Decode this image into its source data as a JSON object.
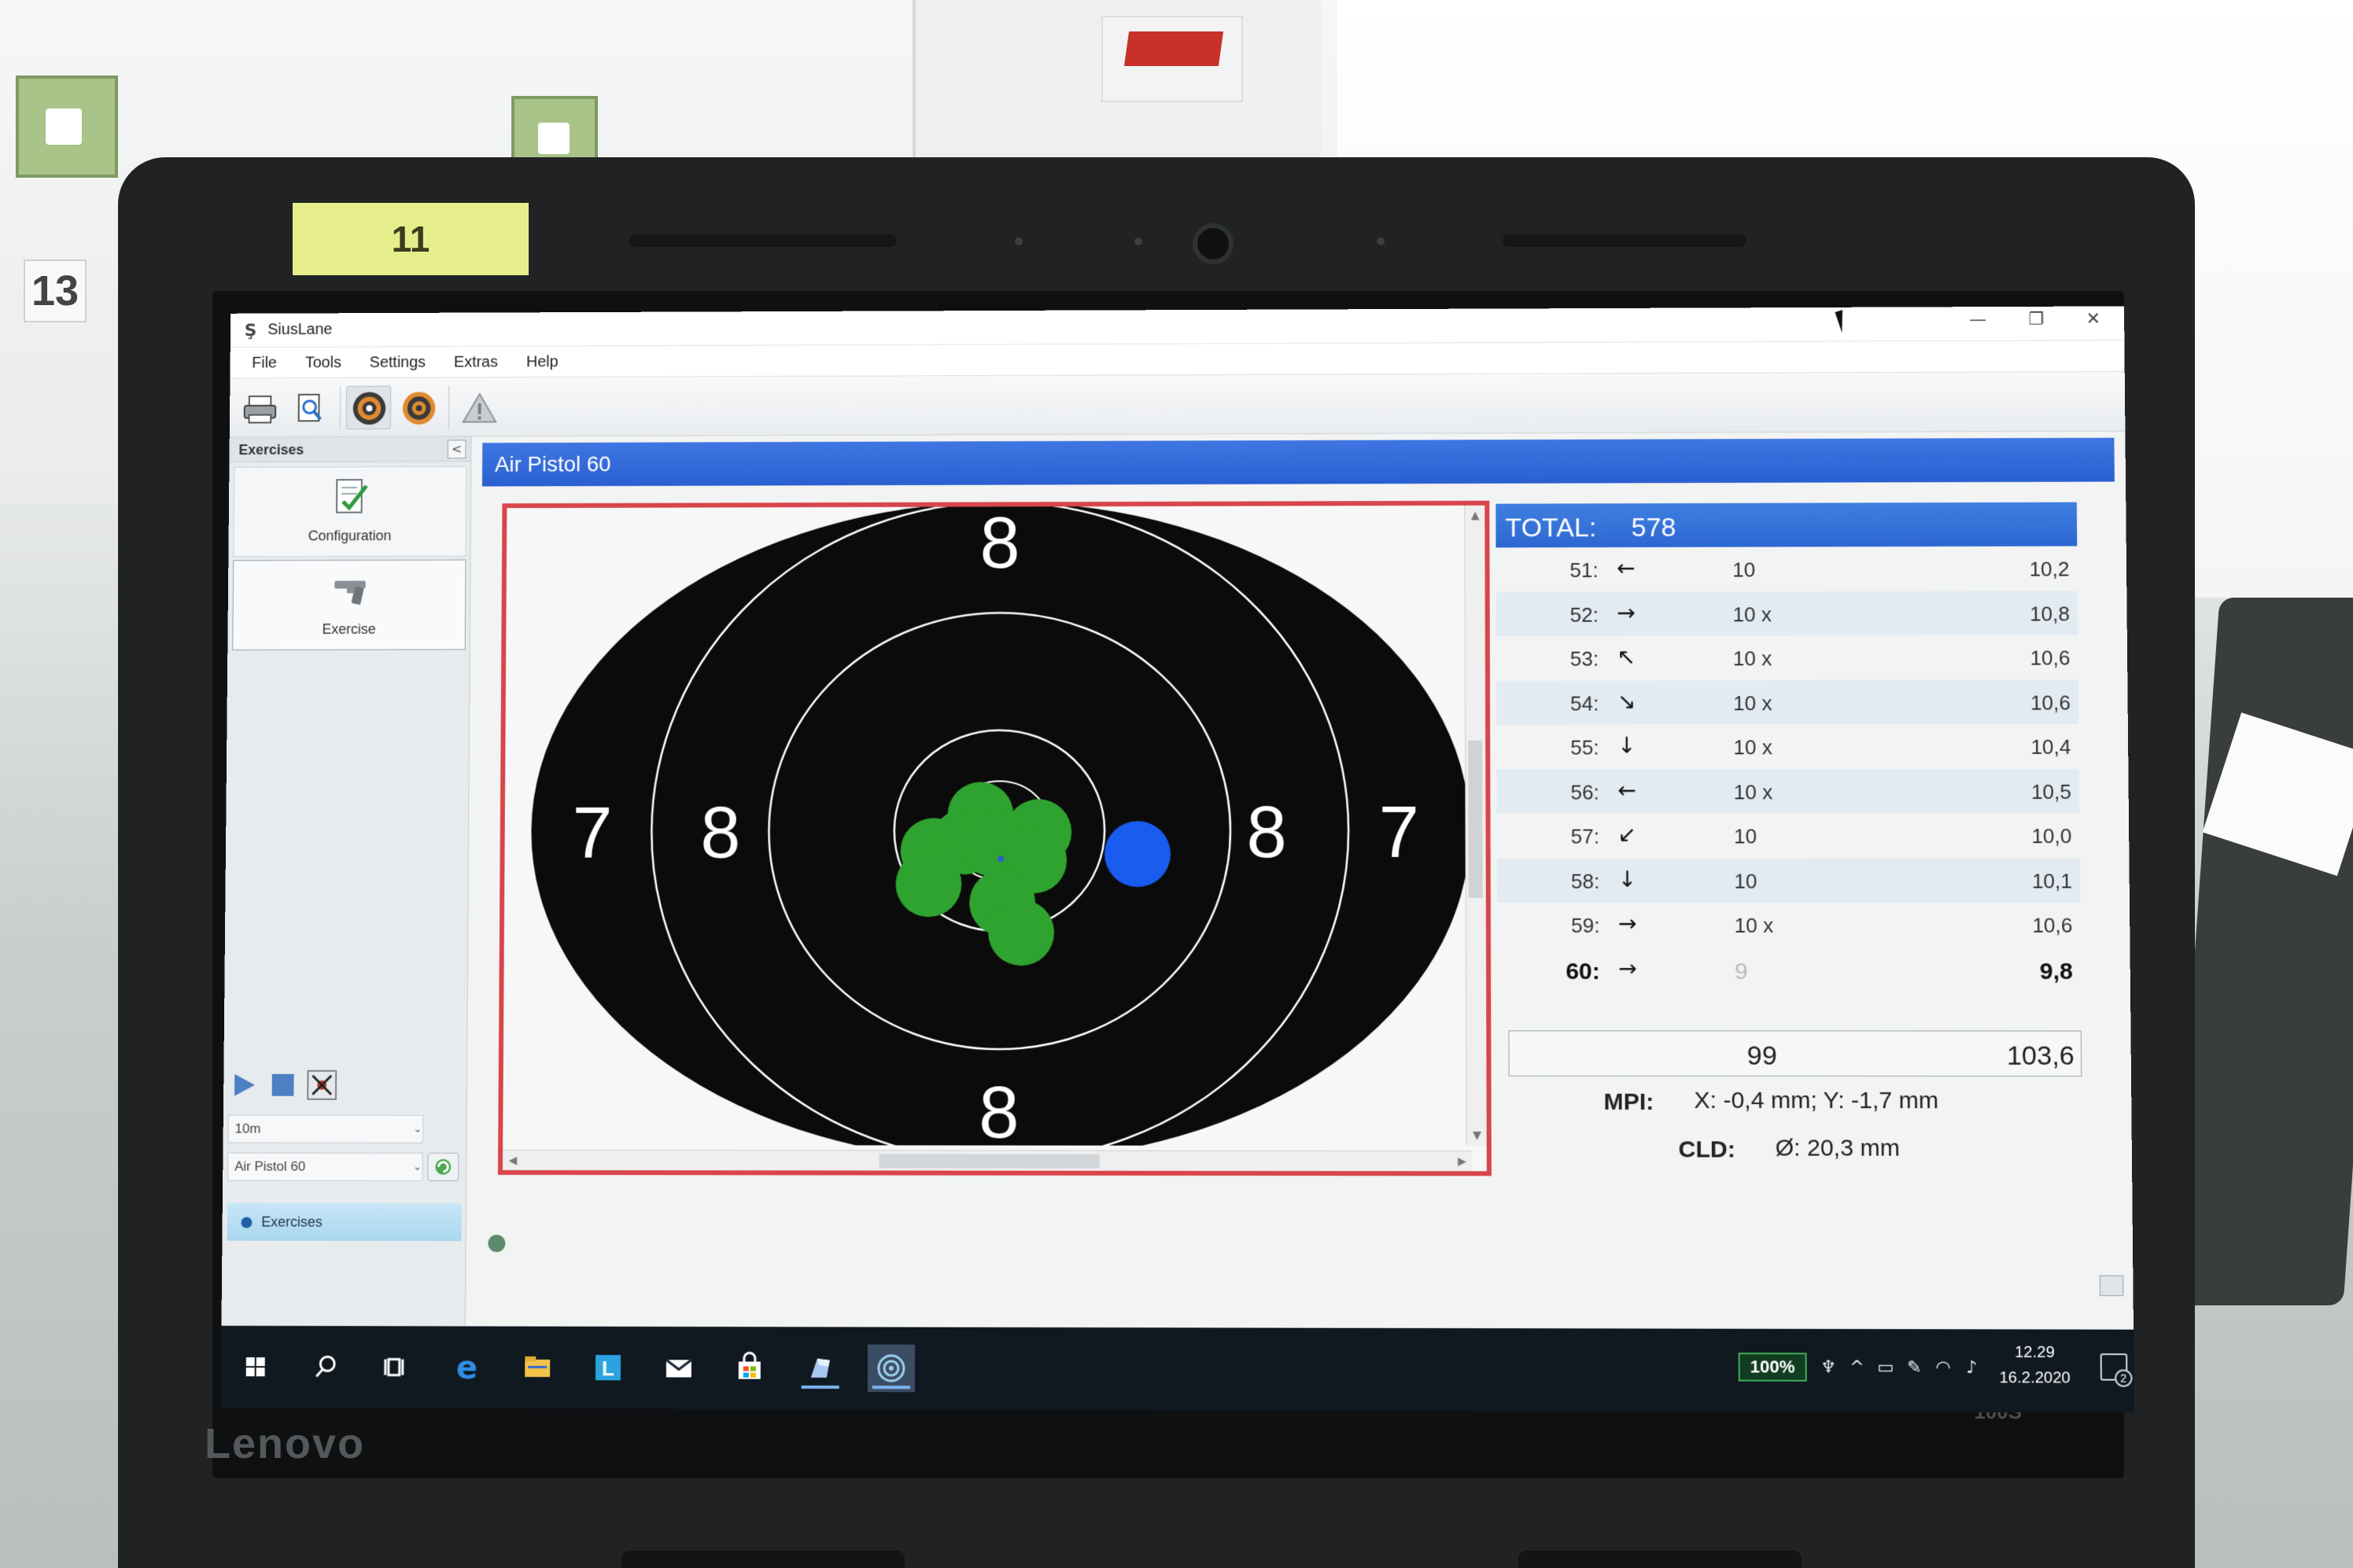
{
  "environment": {
    "lane_number_sticker": "11",
    "wall_lane_number": "13",
    "laptop_brand": "Lenovo",
    "laptop_model": "100S"
  },
  "window": {
    "title": "SiusLane",
    "controls": {
      "minimize": "—",
      "maximize": "❐",
      "close": "✕"
    }
  },
  "menu": [
    "File",
    "Tools",
    "Settings",
    "Extras",
    "Help"
  ],
  "toolbar": {
    "icons": [
      "printer-icon",
      "print-preview-icon",
      "target-view-icon",
      "target-score-icon",
      "warning-icon"
    ]
  },
  "sidebar": {
    "header": "Exercises",
    "collapse": "<",
    "items": [
      {
        "label": "Configuration",
        "icon": "configuration-icon"
      },
      {
        "label": "Exercise",
        "icon": "pistol-icon"
      }
    ],
    "distance": "10m",
    "program": "Air Pistol 60",
    "nav": "Exercises"
  },
  "main": {
    "title": "Air Pistol 60",
    "target": {
      "ring_labels": {
        "top": "8",
        "bottom": "8",
        "left_outer": "7",
        "left_inner": "8",
        "right_inner": "8",
        "right_outer": "7"
      },
      "shot_color": "#2fa32f",
      "last_shot_color": "#1a5cf0"
    },
    "total_label": "TOTAL:",
    "total_value": "578",
    "shots": [
      {
        "num": "51:",
        "dir": "←",
        "val": "10",
        "dec": "10,2"
      },
      {
        "num": "52:",
        "dir": "→",
        "val": "10 x",
        "dec": "10,8"
      },
      {
        "num": "53:",
        "dir": "↖",
        "val": "10 x",
        "dec": "10,6"
      },
      {
        "num": "54:",
        "dir": "↘",
        "val": "10 x",
        "dec": "10,6"
      },
      {
        "num": "55:",
        "dir": "↓",
        "val": "10 x",
        "dec": "10,4"
      },
      {
        "num": "56:",
        "dir": "←",
        "val": "10 x",
        "dec": "10,5"
      },
      {
        "num": "57:",
        "dir": "↙",
        "val": "10",
        "dec": "10,0"
      },
      {
        "num": "58:",
        "dir": "↓",
        "val": "10",
        "dec": "10,1"
      },
      {
        "num": "59:",
        "dir": "→",
        "val": "10 x",
        "dec": "10,6"
      },
      {
        "num": "60:",
        "dir": "→",
        "val": "9",
        "dec": "9,8"
      }
    ],
    "series_sum": "99",
    "series_sum_decimal": "103,6",
    "mpi_label": "MPI:",
    "mpi_value": "X: -0,4 mm; Y: -1,7 mm",
    "cld_label": "CLD:",
    "cld_value": "Ø: 20,3 mm"
  },
  "taskbar": {
    "apps": [
      "windows-start-icon",
      "search-icon",
      "task-view-icon",
      "edge-icon",
      "file-explorer-icon",
      "store-l-icon",
      "mail-icon",
      "store-bag-icon",
      "app-pen-icon",
      "siuslane-icon"
    ],
    "battery": "100%",
    "time": "12.29",
    "date": "16.2.2020",
    "notifications": "2"
  }
}
